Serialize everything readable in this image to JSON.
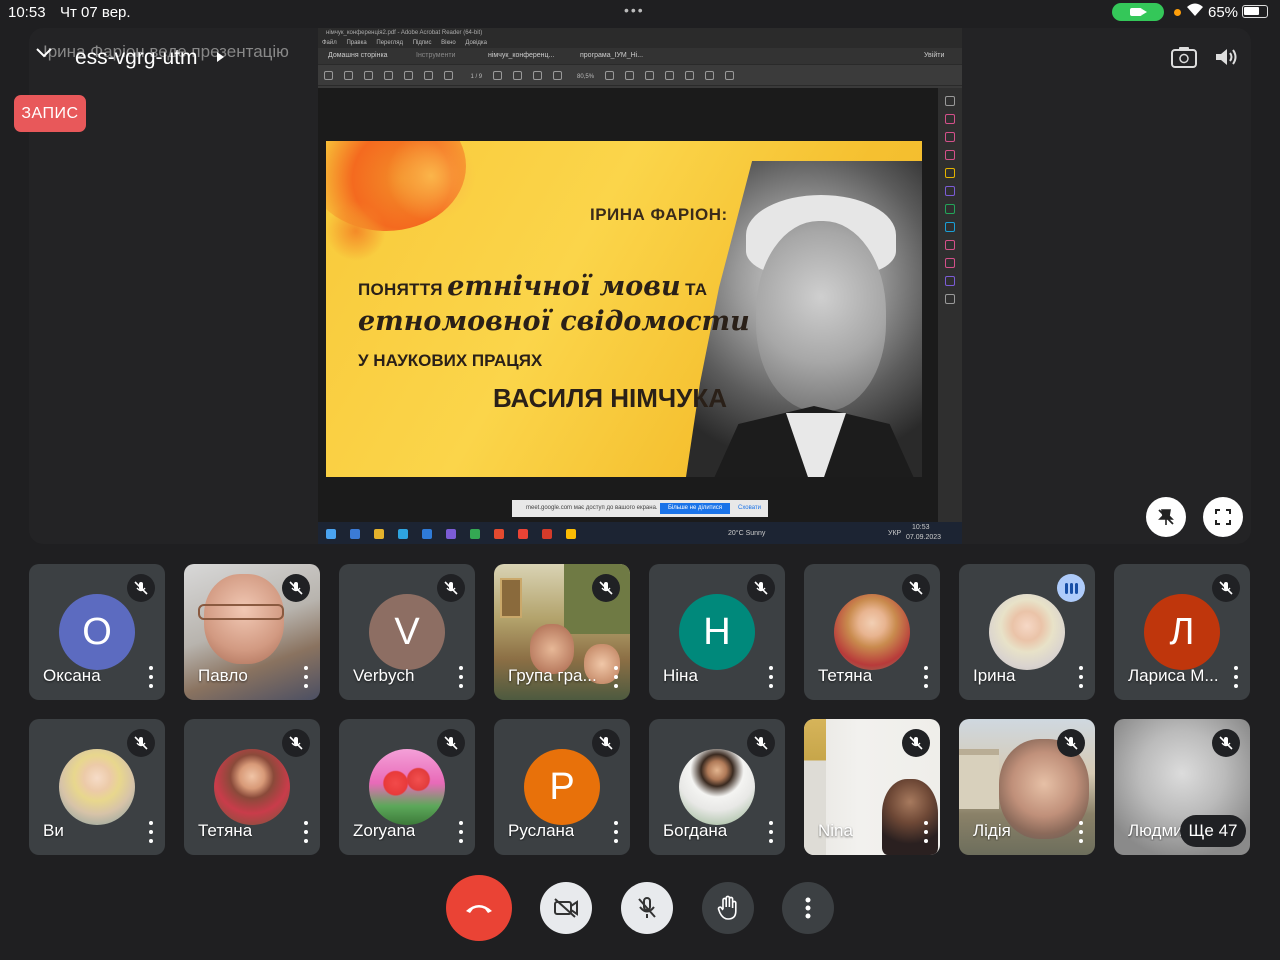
{
  "status_bar": {
    "time": "10:53",
    "date": "Чт 07 вер.",
    "battery": "65%"
  },
  "presentation": {
    "owner_label": "Ірина Фаріон веде презентацію",
    "meeting_code": "ess-vgrg-utm",
    "recording_badge": "ЗАПИС",
    "shared_screen": {
      "window_title": "німчук_конференція2.pdf - Adobe Acrobat Reader (64-bit)",
      "menu": [
        "Файл",
        "Правка",
        "Перегляд",
        "Підпис",
        "Вікно",
        "Довідка"
      ],
      "tabs": [
        "Домашня сторінка",
        "Інструменти",
        "німчук_конференц...",
        "програма_ІУМ_Ні..."
      ],
      "signin": "Увійти",
      "page_counter": "1 / 9",
      "zoom": "80,5%",
      "share_notice": "meet.google.com має доступ до вашого екрана.",
      "share_stop": "Більше не ділитися",
      "share_hide": "Сховати",
      "weather": "20°C Sunny",
      "clock": "10:53",
      "clock_date": "07.09.2023",
      "keyboard_lang": "УКР"
    },
    "slide": {
      "author": "ІРИНА ФАРІОН:",
      "line1_prefix": "ПОНЯТТЯ",
      "line1_italic": "етнічної мови",
      "line1_suffix": "ТА",
      "line2": "етномовної свідомости",
      "line3": "У НАУКОВИХ ПРАЦЯХ",
      "line4": "ВАСИЛЯ НІМЧУКА"
    }
  },
  "participants_row1": [
    {
      "name": "Оксана",
      "initial": "О",
      "color": "#5c6bc0",
      "muted": true
    },
    {
      "name": "Павло",
      "initial": "",
      "color": "",
      "muted": true,
      "video": true
    },
    {
      "name": "Verbych",
      "initial": "V",
      "color": "#8d6e63",
      "muted": true
    },
    {
      "name": "Група гра...",
      "initial": "",
      "color": "",
      "muted": true,
      "video": true
    },
    {
      "name": "Ніна",
      "initial": "Н",
      "color": "#00897b",
      "muted": true
    },
    {
      "name": "Тетяна",
      "initial": "",
      "color": "#c9b89a",
      "muted": true,
      "photo": true
    },
    {
      "name": "Ірина",
      "initial": "",
      "color": "#d9d3cf",
      "muted": false,
      "speaking": true,
      "photo": true
    },
    {
      "name": "Лариса М...",
      "initial": "Л",
      "color": "#bf360c",
      "muted": true
    }
  ],
  "participants_row2": [
    {
      "name": "Ви",
      "initial": "",
      "color": "#d7c3a8",
      "muted": true,
      "photo": true
    },
    {
      "name": "Тетяна",
      "initial": "",
      "color": "#9c6b4e",
      "muted": true,
      "photo": true
    },
    {
      "name": "Zoryana",
      "initial": "",
      "color": "#e35a5a",
      "muted": true,
      "photo": true
    },
    {
      "name": "Руслана",
      "initial": "Р",
      "color": "#e8710a",
      "muted": true
    },
    {
      "name": "Богдана",
      "initial": "",
      "color": "#c8d0c0",
      "muted": true,
      "photo": true
    },
    {
      "name": "Nina",
      "initial": "",
      "color": "",
      "muted": true,
      "video": true
    },
    {
      "name": "Лідія",
      "initial": "",
      "color": "",
      "muted": true,
      "video": true
    },
    {
      "name": "Людмила",
      "initial": "",
      "color": "",
      "muted": true,
      "video": true
    }
  ],
  "more_participants": "Ще 47",
  "colors": {
    "hangup": "#ea4335",
    "recording": "#e8585a",
    "tile": "#3c4043",
    "background": "#1f1f21"
  }
}
